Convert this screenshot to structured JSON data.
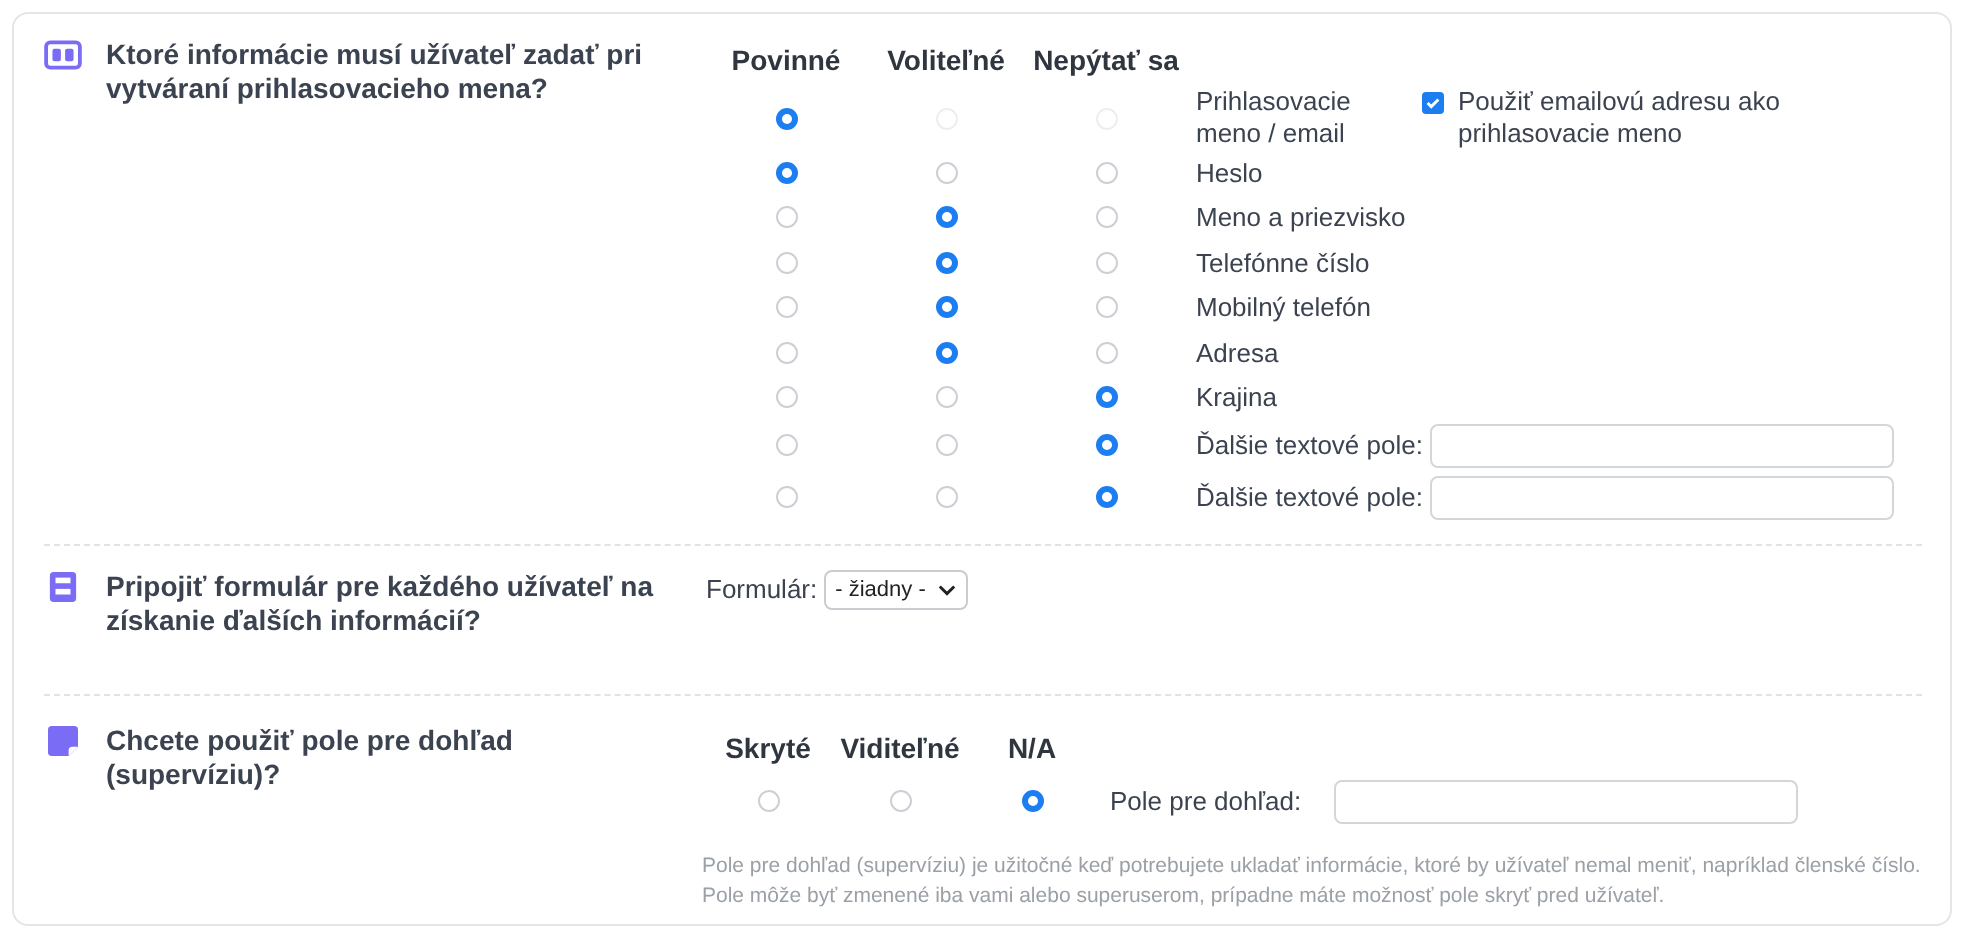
{
  "sections": [
    {
      "kind": "matrix",
      "title": "Ktoré informácie musí užívateľ zadať pri vytváraní prihlasovacieho mena?",
      "columns": [
        "Povinné",
        "Voliteľné",
        "Nepýtať sa"
      ],
      "rows": [
        {
          "label": "Prihlasovacie meno / email",
          "options": [
            {
              "selected": true,
              "disabled": false
            },
            {
              "selected": false,
              "disabled": true
            },
            {
              "selected": false,
              "disabled": true
            }
          ],
          "checkbox": {
            "label": "Použiť emailovú adresu ako prihlasovacie meno",
            "checked": true
          }
        },
        {
          "label": "Heslo",
          "options": [
            {
              "selected": true,
              "disabled": false
            },
            {
              "selected": false,
              "disabled": false
            },
            {
              "selected": false,
              "disabled": false
            }
          ]
        },
        {
          "label": "Meno a priezvisko",
          "options": [
            {
              "selected": false,
              "disabled": false
            },
            {
              "selected": true,
              "disabled": false
            },
            {
              "selected": false,
              "disabled": false
            }
          ]
        },
        {
          "label": "Telefónne číslo",
          "options": [
            {
              "selected": false,
              "disabled": false
            },
            {
              "selected": true,
              "disabled": false
            },
            {
              "selected": false,
              "disabled": false
            }
          ]
        },
        {
          "label": "Mobilný telefón",
          "options": [
            {
              "selected": false,
              "disabled": false
            },
            {
              "selected": true,
              "disabled": false
            },
            {
              "selected": false,
              "disabled": false
            }
          ]
        },
        {
          "label": "Adresa",
          "options": [
            {
              "selected": false,
              "disabled": false
            },
            {
              "selected": true,
              "disabled": false
            },
            {
              "selected": false,
              "disabled": false
            }
          ]
        },
        {
          "label": "Krajina",
          "options": [
            {
              "selected": false,
              "disabled": false
            },
            {
              "selected": false,
              "disabled": false
            },
            {
              "selected": true,
              "disabled": false
            }
          ]
        },
        {
          "label": "Ďalšie textové pole:",
          "options": [
            {
              "selected": false,
              "disabled": false
            },
            {
              "selected": false,
              "disabled": false
            },
            {
              "selected": true,
              "disabled": false
            }
          ],
          "field": true
        },
        {
          "label": "Ďalšie textové pole:",
          "options": [
            {
              "selected": false,
              "disabled": false
            },
            {
              "selected": false,
              "disabled": false
            },
            {
              "selected": true,
              "disabled": false
            }
          ],
          "field": true
        }
      ]
    },
    {
      "kind": "select",
      "title": "Pripojiť formulár pre každého užívateľ na získanie ďalších informácií?",
      "label": "Formulár:",
      "value": "- žiadny -"
    },
    {
      "kind": "supervision",
      "title": "Chcete použiť pole pre dohľad (supervíziu)?",
      "columns": [
        "Skryté",
        "Viditeľné",
        "N/A"
      ],
      "options": [
        {
          "selected": false
        },
        {
          "selected": false
        },
        {
          "selected": true
        }
      ],
      "field_label": "Pole pre dohľad:",
      "help": "Pole pre dohľad (supervíziu) je užitočné keď potrebujete ukladať informácie, ktoré by užívateľ nemal meniť, napríklad členské číslo. Pole môže byť zmenené iba vami alebo superuserom, prípadne máte možnosť pole skryť pred užívateľ."
    }
  ]
}
